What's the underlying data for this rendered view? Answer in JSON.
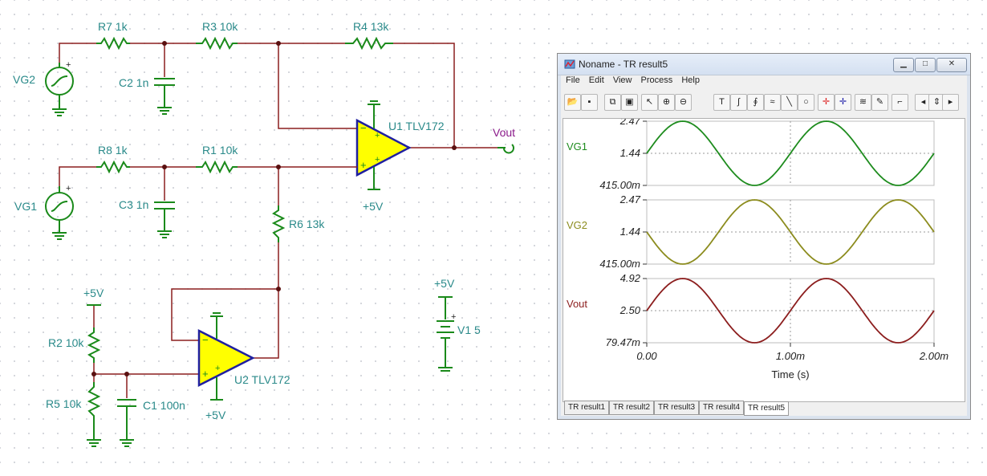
{
  "schematic": {
    "labels": {
      "r7": "R7 1k",
      "r3": "R3 10k",
      "r4": "R4 13k",
      "vg2": "VG2",
      "c2": "C2 1n",
      "u1": "U1 TLV172",
      "vout": "Vout",
      "r8": "R8 1k",
      "r1": "R1 10k",
      "vg1": "VG1",
      "c3": "C3 1n",
      "u1_supply": "+5V",
      "r6": "R6 13k",
      "r2_supply": "+5V",
      "r2": "R2 10k",
      "r5": "R5 10k",
      "c1": "C1 100n",
      "u2": "U2 TLV172",
      "u2_supply": "+5V",
      "v1_supply": "+5V",
      "v1": "V1 5"
    },
    "colors": {
      "wire": "#8b1e1e",
      "component": "#1a8a1a",
      "label": "#2a8a8a",
      "opamp_fill": "#ffff00",
      "opamp_outline": "#1f1fa0",
      "vout_label": "#8a1a8a"
    }
  },
  "window": {
    "title": "Noname - TR result5",
    "menu": [
      "File",
      "Edit",
      "View",
      "Process",
      "Help"
    ],
    "toolbar_icons": [
      "open-icon",
      "save-icon",
      "copy-icon",
      "paste-icon",
      "pointer-icon",
      "zoom-in-icon",
      "zoom-out-icon",
      "text-icon",
      "draw-curve-icon",
      "draw-curve2-icon",
      "draw-curve3-icon",
      "line-icon",
      "circle-icon",
      "cursor-a-icon",
      "cursor-b-icon",
      "add-trace-icon",
      "pen-icon",
      "step-icon",
      "prev-icon",
      "updown-icon",
      "next-icon"
    ],
    "tabs": [
      "TR result1",
      "TR result2",
      "TR result3",
      "TR result4",
      "TR result5"
    ],
    "active_tab": 4
  },
  "chart_data": {
    "type": "line",
    "xlabel": "Time (s)",
    "x_ticks": [
      "0.00",
      "1.00m",
      "2.00m"
    ],
    "xlim": [
      0,
      0.002
    ],
    "panels": [
      {
        "name": "VG1",
        "color": "#1e8c1e",
        "ticks": [
          "2.47",
          "1.44",
          "415.00m"
        ],
        "ylim": [
          0.415,
          2.47
        ],
        "amplitude": 1.0275,
        "offset": 1.4425,
        "frequency_hz": 1000,
        "phase_deg": 0
      },
      {
        "name": "VG2",
        "color": "#8c8c1e",
        "ticks": [
          "2.47",
          "1.44",
          "415.00m"
        ],
        "ylim": [
          0.415,
          2.47
        ],
        "amplitude": 1.0275,
        "offset": 1.4425,
        "frequency_hz": 1000,
        "phase_deg": 180
      },
      {
        "name": "Vout",
        "color": "#8c1e1e",
        "ticks": [
          "4.92",
          "2.50",
          "79.47m"
        ],
        "ylim": [
          0.07947,
          4.92
        ],
        "amplitude": 2.42,
        "offset": 2.5,
        "frequency_hz": 1000,
        "phase_deg": 0
      }
    ]
  }
}
